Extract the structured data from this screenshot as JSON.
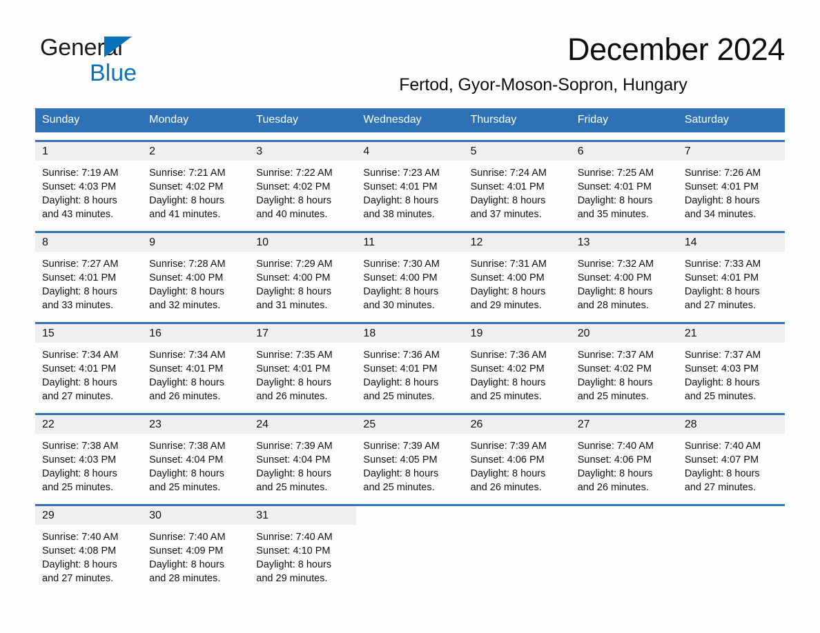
{
  "brand": {
    "line1": "General",
    "line2": "Blue",
    "accent_color": "#0b72b9"
  },
  "header": {
    "title": "December 2024",
    "subtitle": "Fertod, Gyor-Moson-Sopron, Hungary"
  },
  "theme": {
    "header_blue": "#2e72b5",
    "daynum_band": "#efefef",
    "page_background": "#fdfdfd",
    "text": "#111111"
  },
  "weekdays": [
    "Sunday",
    "Monday",
    "Tuesday",
    "Wednesday",
    "Thursday",
    "Friday",
    "Saturday"
  ],
  "weeks": [
    [
      {
        "day": "1",
        "sunrise": "Sunrise: 7:19 AM",
        "sunset": "Sunset: 4:03 PM",
        "daylight_line1": "Daylight: 8 hours",
        "daylight_line2": "and 43 minutes."
      },
      {
        "day": "2",
        "sunrise": "Sunrise: 7:21 AM",
        "sunset": "Sunset: 4:02 PM",
        "daylight_line1": "Daylight: 8 hours",
        "daylight_line2": "and 41 minutes."
      },
      {
        "day": "3",
        "sunrise": "Sunrise: 7:22 AM",
        "sunset": "Sunset: 4:02 PM",
        "daylight_line1": "Daylight: 8 hours",
        "daylight_line2": "and 40 minutes."
      },
      {
        "day": "4",
        "sunrise": "Sunrise: 7:23 AM",
        "sunset": "Sunset: 4:01 PM",
        "daylight_line1": "Daylight: 8 hours",
        "daylight_line2": "and 38 minutes."
      },
      {
        "day": "5",
        "sunrise": "Sunrise: 7:24 AM",
        "sunset": "Sunset: 4:01 PM",
        "daylight_line1": "Daylight: 8 hours",
        "daylight_line2": "and 37 minutes."
      },
      {
        "day": "6",
        "sunrise": "Sunrise: 7:25 AM",
        "sunset": "Sunset: 4:01 PM",
        "daylight_line1": "Daylight: 8 hours",
        "daylight_line2": "and 35 minutes."
      },
      {
        "day": "7",
        "sunrise": "Sunrise: 7:26 AM",
        "sunset": "Sunset: 4:01 PM",
        "daylight_line1": "Daylight: 8 hours",
        "daylight_line2": "and 34 minutes."
      }
    ],
    [
      {
        "day": "8",
        "sunrise": "Sunrise: 7:27 AM",
        "sunset": "Sunset: 4:01 PM",
        "daylight_line1": "Daylight: 8 hours",
        "daylight_line2": "and 33 minutes."
      },
      {
        "day": "9",
        "sunrise": "Sunrise: 7:28 AM",
        "sunset": "Sunset: 4:00 PM",
        "daylight_line1": "Daylight: 8 hours",
        "daylight_line2": "and 32 minutes."
      },
      {
        "day": "10",
        "sunrise": "Sunrise: 7:29 AM",
        "sunset": "Sunset: 4:00 PM",
        "daylight_line1": "Daylight: 8 hours",
        "daylight_line2": "and 31 minutes."
      },
      {
        "day": "11",
        "sunrise": "Sunrise: 7:30 AM",
        "sunset": "Sunset: 4:00 PM",
        "daylight_line1": "Daylight: 8 hours",
        "daylight_line2": "and 30 minutes."
      },
      {
        "day": "12",
        "sunrise": "Sunrise: 7:31 AM",
        "sunset": "Sunset: 4:00 PM",
        "daylight_line1": "Daylight: 8 hours",
        "daylight_line2": "and 29 minutes."
      },
      {
        "day": "13",
        "sunrise": "Sunrise: 7:32 AM",
        "sunset": "Sunset: 4:00 PM",
        "daylight_line1": "Daylight: 8 hours",
        "daylight_line2": "and 28 minutes."
      },
      {
        "day": "14",
        "sunrise": "Sunrise: 7:33 AM",
        "sunset": "Sunset: 4:01 PM",
        "daylight_line1": "Daylight: 8 hours",
        "daylight_line2": "and 27 minutes."
      }
    ],
    [
      {
        "day": "15",
        "sunrise": "Sunrise: 7:34 AM",
        "sunset": "Sunset: 4:01 PM",
        "daylight_line1": "Daylight: 8 hours",
        "daylight_line2": "and 27 minutes."
      },
      {
        "day": "16",
        "sunrise": "Sunrise: 7:34 AM",
        "sunset": "Sunset: 4:01 PM",
        "daylight_line1": "Daylight: 8 hours",
        "daylight_line2": "and 26 minutes."
      },
      {
        "day": "17",
        "sunrise": "Sunrise: 7:35 AM",
        "sunset": "Sunset: 4:01 PM",
        "daylight_line1": "Daylight: 8 hours",
        "daylight_line2": "and 26 minutes."
      },
      {
        "day": "18",
        "sunrise": "Sunrise: 7:36 AM",
        "sunset": "Sunset: 4:01 PM",
        "daylight_line1": "Daylight: 8 hours",
        "daylight_line2": "and 25 minutes."
      },
      {
        "day": "19",
        "sunrise": "Sunrise: 7:36 AM",
        "sunset": "Sunset: 4:02 PM",
        "daylight_line1": "Daylight: 8 hours",
        "daylight_line2": "and 25 minutes."
      },
      {
        "day": "20",
        "sunrise": "Sunrise: 7:37 AM",
        "sunset": "Sunset: 4:02 PM",
        "daylight_line1": "Daylight: 8 hours",
        "daylight_line2": "and 25 minutes."
      },
      {
        "day": "21",
        "sunrise": "Sunrise: 7:37 AM",
        "sunset": "Sunset: 4:03 PM",
        "daylight_line1": "Daylight: 8 hours",
        "daylight_line2": "and 25 minutes."
      }
    ],
    [
      {
        "day": "22",
        "sunrise": "Sunrise: 7:38 AM",
        "sunset": "Sunset: 4:03 PM",
        "daylight_line1": "Daylight: 8 hours",
        "daylight_line2": "and 25 minutes."
      },
      {
        "day": "23",
        "sunrise": "Sunrise: 7:38 AM",
        "sunset": "Sunset: 4:04 PM",
        "daylight_line1": "Daylight: 8 hours",
        "daylight_line2": "and 25 minutes."
      },
      {
        "day": "24",
        "sunrise": "Sunrise: 7:39 AM",
        "sunset": "Sunset: 4:04 PM",
        "daylight_line1": "Daylight: 8 hours",
        "daylight_line2": "and 25 minutes."
      },
      {
        "day": "25",
        "sunrise": "Sunrise: 7:39 AM",
        "sunset": "Sunset: 4:05 PM",
        "daylight_line1": "Daylight: 8 hours",
        "daylight_line2": "and 25 minutes."
      },
      {
        "day": "26",
        "sunrise": "Sunrise: 7:39 AM",
        "sunset": "Sunset: 4:06 PM",
        "daylight_line1": "Daylight: 8 hours",
        "daylight_line2": "and 26 minutes."
      },
      {
        "day": "27",
        "sunrise": "Sunrise: 7:40 AM",
        "sunset": "Sunset: 4:06 PM",
        "daylight_line1": "Daylight: 8 hours",
        "daylight_line2": "and 26 minutes."
      },
      {
        "day": "28",
        "sunrise": "Sunrise: 7:40 AM",
        "sunset": "Sunset: 4:07 PM",
        "daylight_line1": "Daylight: 8 hours",
        "daylight_line2": "and 27 minutes."
      }
    ],
    [
      {
        "day": "29",
        "sunrise": "Sunrise: 7:40 AM",
        "sunset": "Sunset: 4:08 PM",
        "daylight_line1": "Daylight: 8 hours",
        "daylight_line2": "and 27 minutes."
      },
      {
        "day": "30",
        "sunrise": "Sunrise: 7:40 AM",
        "sunset": "Sunset: 4:09 PM",
        "daylight_line1": "Daylight: 8 hours",
        "daylight_line2": "and 28 minutes."
      },
      {
        "day": "31",
        "sunrise": "Sunrise: 7:40 AM",
        "sunset": "Sunset: 4:10 PM",
        "daylight_line1": "Daylight: 8 hours",
        "daylight_line2": "and 29 minutes."
      },
      {
        "day": "",
        "sunrise": "",
        "sunset": "",
        "daylight_line1": "",
        "daylight_line2": ""
      },
      {
        "day": "",
        "sunrise": "",
        "sunset": "",
        "daylight_line1": "",
        "daylight_line2": ""
      },
      {
        "day": "",
        "sunrise": "",
        "sunset": "",
        "daylight_line1": "",
        "daylight_line2": ""
      },
      {
        "day": "",
        "sunrise": "",
        "sunset": "",
        "daylight_line1": "",
        "daylight_line2": ""
      }
    ]
  ]
}
